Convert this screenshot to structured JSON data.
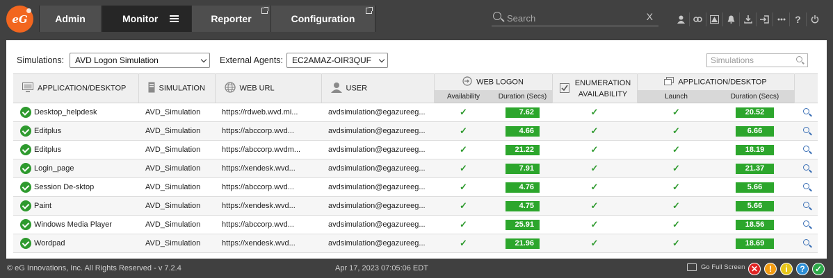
{
  "nav": {
    "logo_text": "eG",
    "items": [
      {
        "label": "Admin"
      },
      {
        "label": "Monitor"
      },
      {
        "label": "Reporter"
      },
      {
        "label": "Configuration"
      }
    ],
    "search_placeholder": "Search",
    "search_clear": "X",
    "icons": [
      "user-icon",
      "link-icon",
      "alert-icon",
      "bell-icon",
      "download-icon",
      "signin-icon",
      "more-icon",
      "help-icon",
      "power-icon"
    ]
  },
  "filters": {
    "simulations_label": "Simulations:",
    "simulations_value": "AVD Logon Simulation",
    "agents_label": "External Agents:",
    "agents_value": "EC2AMAZ-OIR3QUF",
    "search_placeholder": "Simulations"
  },
  "table": {
    "headers": {
      "app": "APPLICATION/DESKTOP",
      "simulation": "SIMULATION",
      "weburl": "WEB URL",
      "user": "USER",
      "weblogon": "WEB LOGON",
      "weblogon_availability": "Availability",
      "weblogon_duration": "Duration (Secs)",
      "enumeration_line1": "ENUMERATION",
      "enumeration_line2": "AVAILABILITY",
      "appdesktop": "APPLICATION/DESKTOP",
      "appdesktop_launch": "Launch",
      "appdesktop_duration": "Duration (Secs)"
    },
    "rows": [
      {
        "app": "Desktop_helpdesk",
        "simulation": "AVD_Simulation",
        "url": "https://rdweb.wvd.mi...",
        "user": "avdsimulation@egazureeg...",
        "logon_duration": "7.62",
        "launch_duration": "20.52"
      },
      {
        "app": "Editplus",
        "simulation": "AVD_Simulation",
        "url": "https://abccorp.wvd...",
        "user": "avdsimulation@egazureeg...",
        "logon_duration": "4.66",
        "launch_duration": "6.66"
      },
      {
        "app": "Editplus",
        "simulation": "AVD_Simulation",
        "url": "https://abccorp.wvdm...",
        "user": "avdsimulation@egazureeg...",
        "logon_duration": "21.22",
        "launch_duration": "18.19"
      },
      {
        "app": "Login_page",
        "simulation": "AVD_Simulation",
        "url": "https://xendesk.wvd...",
        "user": "avdsimulation@egazureeg...",
        "logon_duration": "7.91",
        "launch_duration": "21.37"
      },
      {
        "app": "Session De-sktop",
        "simulation": "AVD_Simulation",
        "url": "https://abccorp.wvd...",
        "user": "avdsimulation@egazureeg...",
        "logon_duration": "4.76",
        "launch_duration": "5.66"
      },
      {
        "app": "Paint",
        "simulation": "AVD_Simulation",
        "url": "https://xendesk.wvd...",
        "user": "avdsimulation@egazureeg...",
        "logon_duration": "4.75",
        "launch_duration": "5.66"
      },
      {
        "app": "Windows Media Player",
        "simulation": "AVD_Simulation",
        "url": "https://abccorp.wvd...",
        "user": "avdsimulation@egazureeg...",
        "logon_duration": "25.91",
        "launch_duration": "18.56"
      },
      {
        "app": "Wordpad",
        "simulation": "AVD_Simulation",
        "url": "https://xendesk.wvd...",
        "user": "avdsimulation@egazureeg...",
        "logon_duration": "21.96",
        "launch_duration": "18.69"
      }
    ],
    "tick": "✓"
  },
  "footer": {
    "copyright": "© eG Innovations, Inc. All Rights Reserved - v 7.2.4",
    "timestamp": "Apr 17, 2023 07:05:06 EDT",
    "fullscreen": "Go Full Screen",
    "status": [
      {
        "glyph": "✕",
        "color": "#e02424"
      },
      {
        "glyph": "!",
        "color": "#f39c12"
      },
      {
        "glyph": "i",
        "color": "#e6c619"
      },
      {
        "glyph": "?",
        "color": "#2d8fd6"
      },
      {
        "glyph": "✓",
        "color": "#2ea84a"
      }
    ]
  }
}
